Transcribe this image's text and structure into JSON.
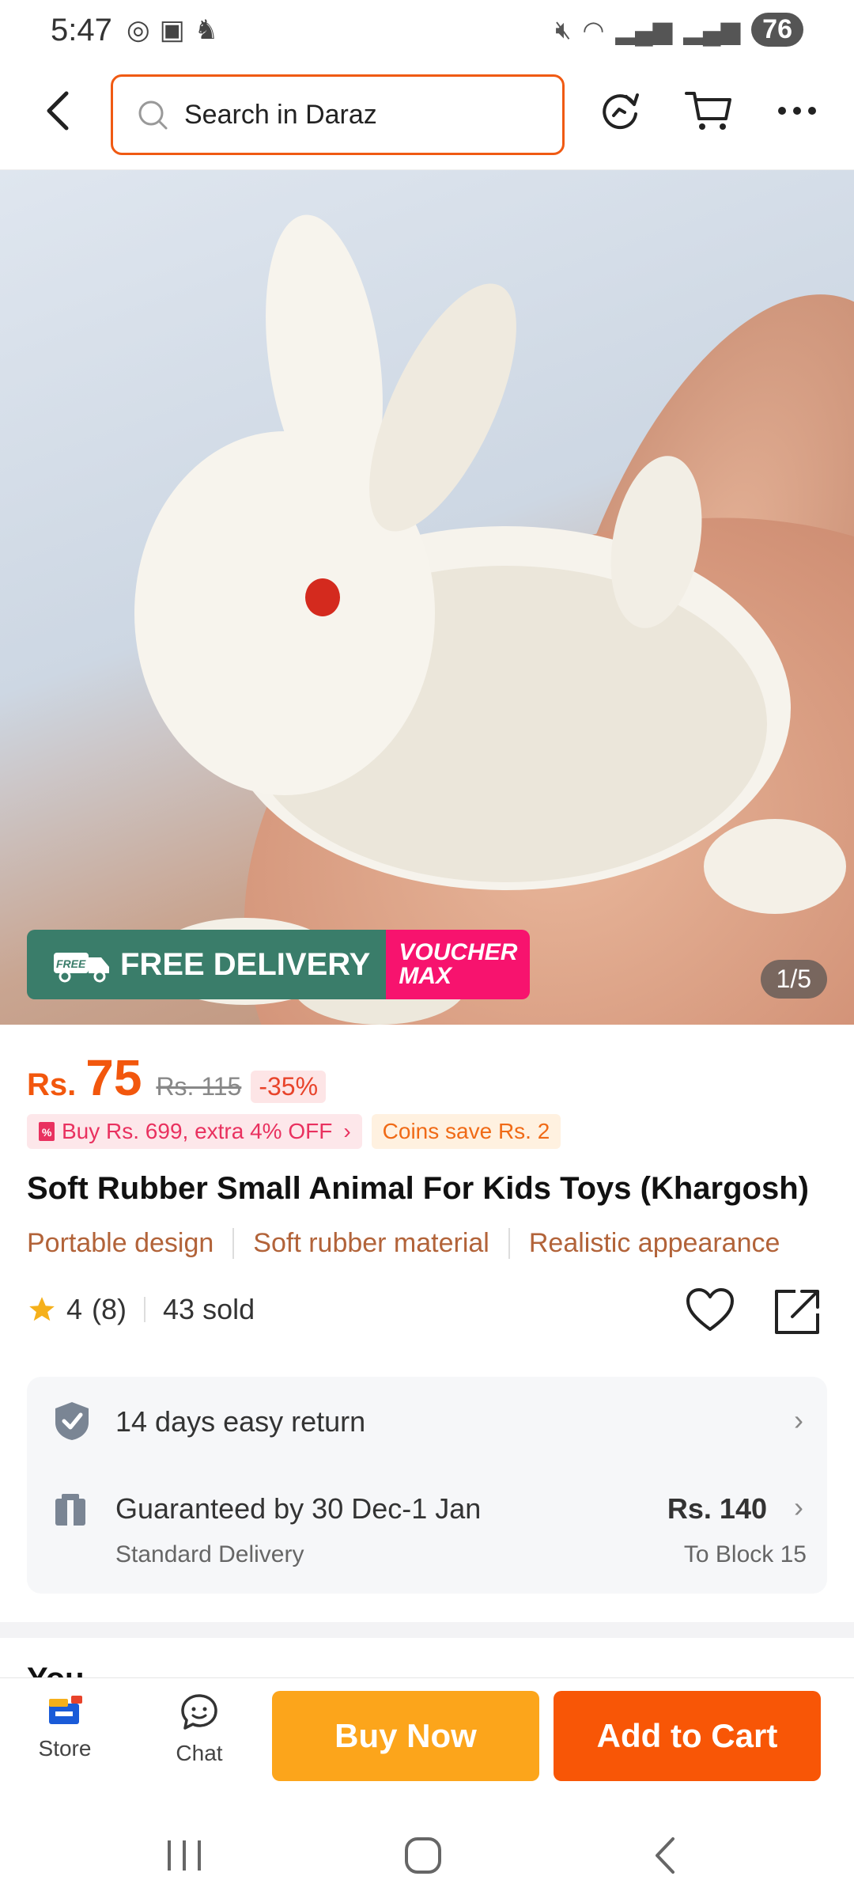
{
  "status_bar": {
    "time": "5:47",
    "battery": "76"
  },
  "search": {
    "placeholder": "Search in Daraz"
  },
  "product_image": {
    "badge_free": "FREE DELIVERY",
    "badge_free_small": "FREE",
    "badge_voucher_line1": "VOUCHER",
    "badge_voucher_line2": "MAX",
    "counter": "1/5"
  },
  "price": {
    "currency": "Rs.",
    "value": "75",
    "original": "Rs. 115",
    "discount": "-35%"
  },
  "promos": {
    "bundle": "Buy Rs. 699, extra 4% OFF",
    "coins": "Coins save Rs. 2"
  },
  "product": {
    "title": "Soft Rubber Small Animal For Kids Toys (Khargosh)",
    "features": [
      "Portable design",
      "Soft rubber material",
      "Realistic appearance"
    ],
    "rating": "4",
    "reviews": "(8)",
    "sold": "43 sold"
  },
  "service": {
    "returns": "14 days easy return",
    "delivery": "Guaranteed by 30 Dec-1 Jan",
    "delivery_type": "Standard Delivery",
    "delivery_price": "Rs. 140",
    "delivery_location": "To Block 15"
  },
  "section_peek": "You ",
  "bottom_bar": {
    "store": "Store",
    "chat": "Chat",
    "buy_now": "Buy Now",
    "add_to_cart": "Add to Cart"
  },
  "colors": {
    "accent": "#f85606",
    "buy_now": "#fca51b",
    "price": "#f2570d"
  }
}
